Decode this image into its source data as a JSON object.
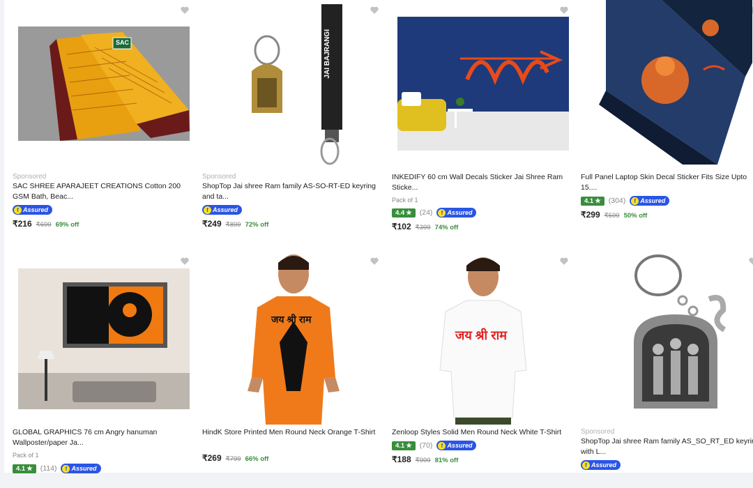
{
  "products": [
    {
      "sponsored": "Sponsored",
      "title": "SAC SHREE APARAJEET CREATIONS Cotton 200 GSM Bath, Beac...",
      "assured": "Assured",
      "price": "₹216",
      "mrp": "₹699",
      "off": "69% off",
      "image": "saffron-towel",
      "logo": "SAC"
    },
    {
      "sponsored": "Sponsored",
      "title": "ShopTop Jai shree Ram family AS-SO-RT-ED keyring and ta...",
      "assured": "Assured",
      "price": "₹249",
      "mrp": "₹899",
      "off": "72% off",
      "image": "keyring-lanyard",
      "lanyard_text": "JAI BAJRANGI"
    },
    {
      "title": "INKEDIFY 60 cm Wall Decals Sticker Jai Shree Ram Sticke...",
      "pack": "Pack of 1",
      "rating": "4.4",
      "reviews": "(24)",
      "assured": "Assured",
      "price": "₹102",
      "mrp": "₹399",
      "off": "74% off",
      "image": "wall-decal"
    },
    {
      "title": "Full Panel Laptop Skin Decal Sticker Fits Size Upto 15....",
      "rating": "4.1",
      "reviews": "(304)",
      "assured": "Assured",
      "price": "₹299",
      "mrp": "₹599",
      "off": "50% off",
      "image": "laptop-skin"
    },
    {
      "title": "GLOBAL GRAPHICS 76 cm Angry hanuman Wallposter/paper Ja...",
      "pack": "Pack of 1",
      "rating": "4.1",
      "reviews": "(114)",
      "assured": "Assured",
      "image": "wall-poster"
    },
    {
      "title": "HindK Store Printed Men Round Neck Orange T-Shirt",
      "price": "₹269",
      "mrp": "₹799",
      "off": "66% off",
      "image": "orange-tshirt",
      "shirt_text": "जय श्री राम"
    },
    {
      "title": "Zenloop Styles Solid Men Round Neck White T-Shirt",
      "rating": "4.1",
      "reviews": "(70)",
      "assured": "Assured",
      "price": "₹188",
      "mrp": "₹999",
      "off": "81% off",
      "image": "white-tshirt",
      "shirt_text": "जय श्री राम"
    },
    {
      "sponsored": "Sponsored",
      "title": "ShopTop Jai shree Ram family AS_SO_RT_ED keyring with L...",
      "assured": "Assured",
      "image": "silver-keyring"
    }
  ],
  "star_glyph": "★",
  "assured_glyph": "f"
}
